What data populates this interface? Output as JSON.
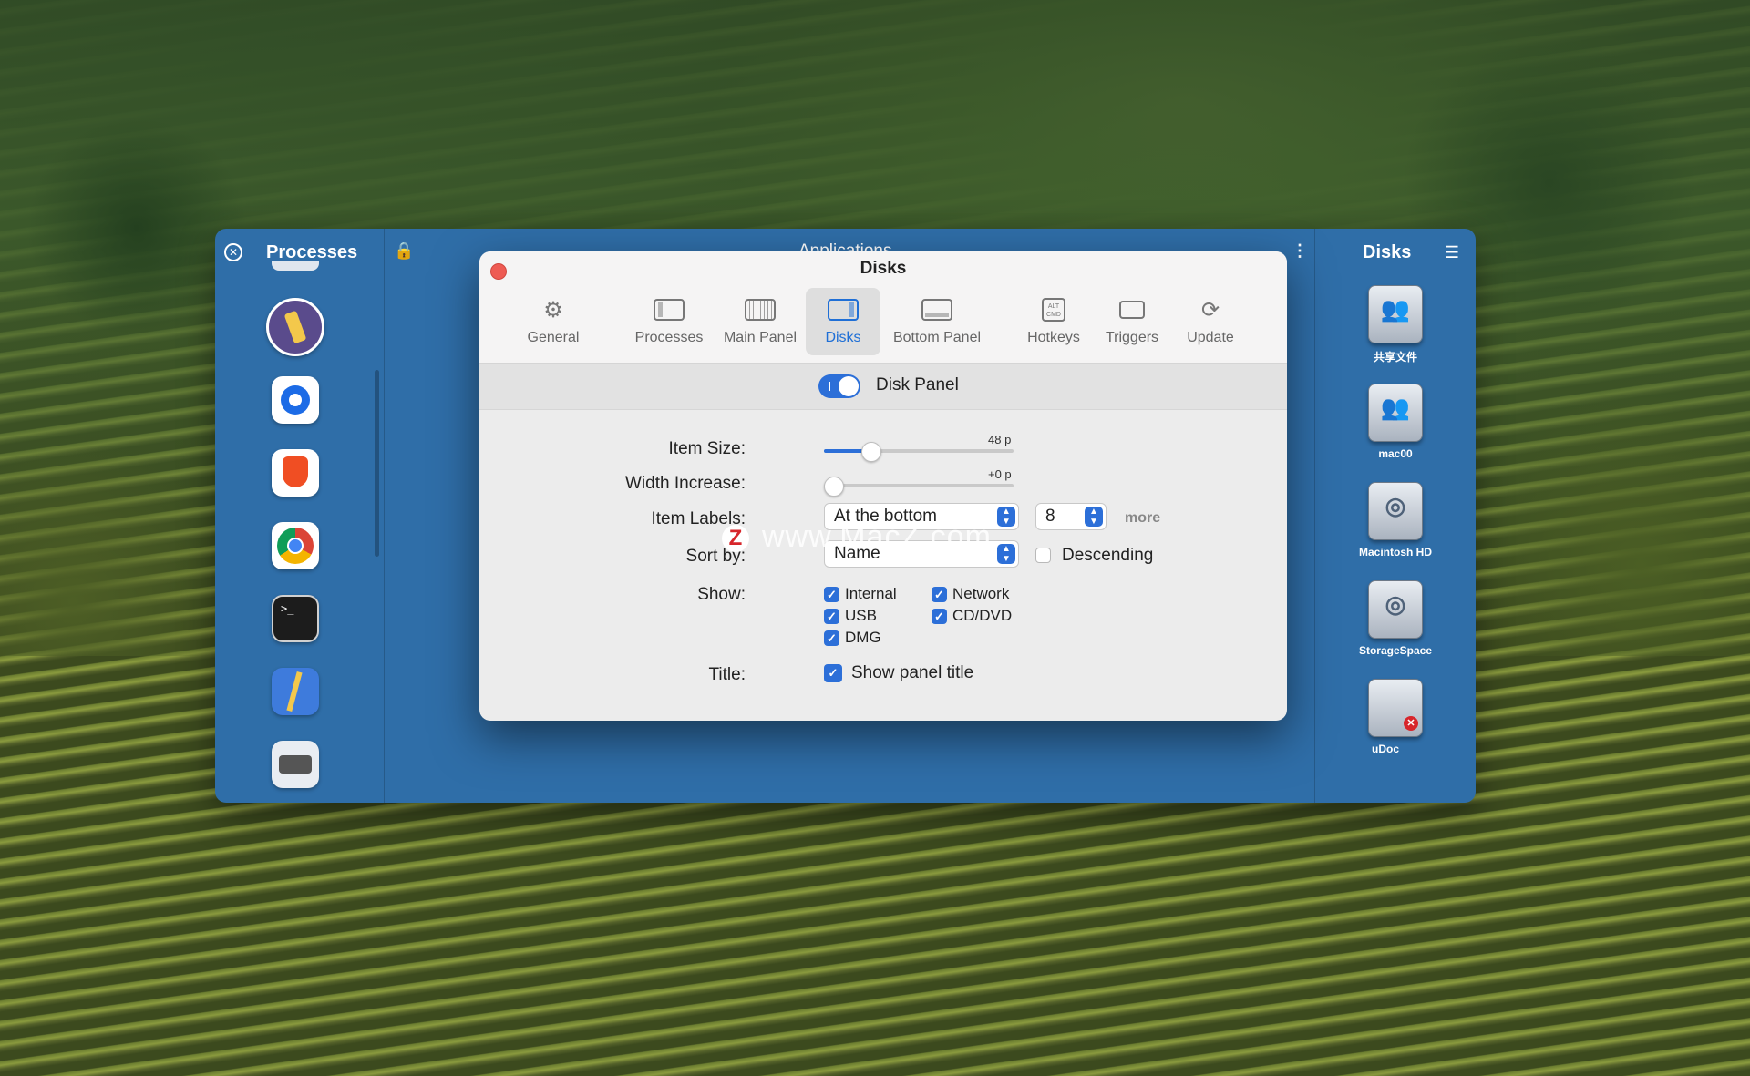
{
  "left_panel": {
    "title": "Processes",
    "close_symbol": "✕",
    "apps": [
      {
        "name": "pencil-mascot-app-icon",
        "color": "#5a4b8c"
      },
      {
        "name": "quickshade-app-icon",
        "color": "#1c6be6"
      },
      {
        "name": "brave-browser-icon",
        "color": "#f04e23"
      },
      {
        "name": "chrome-browser-icon",
        "color": "#2f9e44"
      },
      {
        "name": "terminal-app-icon",
        "color": "#1c1c1c"
      },
      {
        "name": "xcode-like-app-icon",
        "color": "#3e7bdc"
      },
      {
        "name": "printer-app-icon",
        "color": "#e9edf2"
      }
    ]
  },
  "center_panel": {
    "title": "Applications",
    "lock_symbol": "🔒",
    "menu_symbol": "⋮"
  },
  "right_panel": {
    "title": "Disks",
    "menu_symbol": "☰",
    "disks": [
      {
        "label": "共享文件",
        "icon": "network-share-icon",
        "glyph": "👥"
      },
      {
        "label": "mac00",
        "icon": "network-share-icon",
        "glyph": "👥"
      },
      {
        "label": "Macintosh HD",
        "icon": "hard-drive-icon",
        "glyph": "◎"
      },
      {
        "label": "StorageSpace",
        "icon": "hard-drive-icon",
        "glyph": "◎"
      },
      {
        "label": "uDoc",
        "icon": "removable-drive-icon",
        "glyph": ""
      }
    ],
    "help_symbol": "?"
  },
  "dialog": {
    "title": "Disks",
    "tabs": [
      {
        "label": "General",
        "icon": "gear-icon"
      },
      {
        "label": "Processes",
        "icon": "processes-panel-icon"
      },
      {
        "label": "Main Panel",
        "icon": "main-panel-icon"
      },
      {
        "label": "Disks",
        "icon": "disks-panel-icon",
        "active": true
      },
      {
        "label": "Bottom Panel",
        "icon": "bottom-panel-icon"
      },
      {
        "label": "Hotkeys",
        "icon": "keyboard-key-icon"
      },
      {
        "label": "Triggers",
        "icon": "laptop-icon"
      },
      {
        "label": "Update",
        "icon": "refresh-icon"
      }
    ],
    "toggle": {
      "label": "Disk Panel",
      "on": true
    },
    "item_size": {
      "label": "Item Size:",
      "value": "48 p",
      "fraction": 0.22
    },
    "width_increase": {
      "label": "Width Increase:",
      "value": "+0 p",
      "fraction": 0.0
    },
    "item_labels": {
      "label": "Item Labels:",
      "selected": "At the bottom",
      "count": "8",
      "more": "more"
    },
    "sort_by": {
      "label": "Sort by:",
      "selected": "Name",
      "descending_label": "Descending",
      "descending": false
    },
    "show": {
      "label": "Show:",
      "options": [
        {
          "label": "Internal",
          "checked": true
        },
        {
          "label": "Network",
          "checked": true
        },
        {
          "label": "USB",
          "checked": true
        },
        {
          "label": "CD/DVD",
          "checked": true
        },
        {
          "label": "DMG",
          "checked": true
        }
      ]
    },
    "title_option": {
      "label": "Title:",
      "option": "Show panel title",
      "checked": true
    }
  },
  "watermark": {
    "badge": "Z",
    "text": "www.MacZ.com"
  },
  "colors": {
    "accent": "#2c6fd8",
    "window_bg": "#2f6ea8",
    "close_red": "#ee5b53"
  }
}
